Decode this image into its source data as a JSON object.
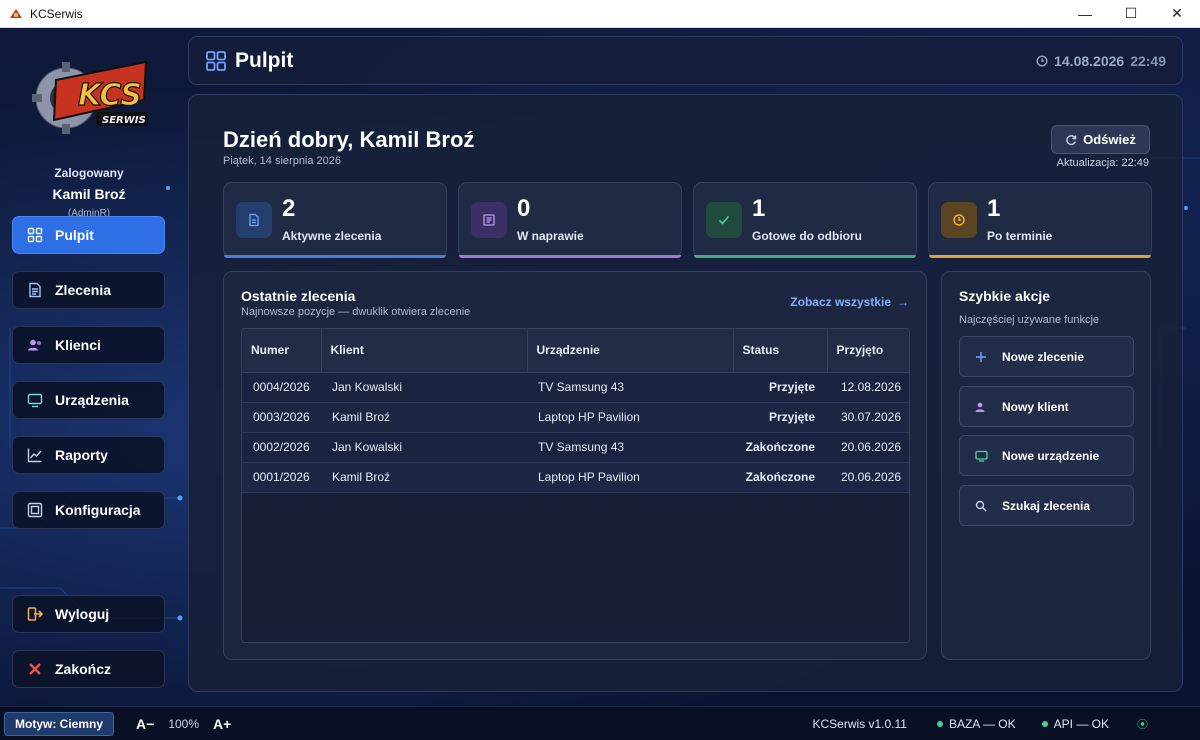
{
  "window": {
    "title": "KCSerwis",
    "controls": [
      "—",
      "☐",
      "✕"
    ]
  },
  "sidebar": {
    "logo_text": "KCS",
    "logo_sub": "SERWIS",
    "logged_label": "Zalogowany",
    "user_name": "Kamil Broź",
    "user_role": "(AdminR)",
    "items": [
      {
        "label": "Pulpit",
        "icon": "dashboard-icon",
        "active": true
      },
      {
        "label": "Zlecenia",
        "icon": "document-icon"
      },
      {
        "label": "Klienci",
        "icon": "users-icon"
      },
      {
        "label": "Urządzenia",
        "icon": "monitor-icon"
      },
      {
        "label": "Raporty",
        "icon": "chart-icon"
      },
      {
        "label": "Konfiguracja",
        "icon": "settings-icon"
      }
    ],
    "logout_label": "Wyloguj",
    "exit_label": "Zakończ"
  },
  "header": {
    "title": "Pulpit",
    "date": "14.08.2026",
    "time": "22:49"
  },
  "main": {
    "greeting": "Dzień dobry, Kamil Broź",
    "date_text": "Piątek, 14 sierpnia 2026",
    "refresh_label": "Odśwież",
    "updated_text": "Aktualizacja: 22:49",
    "stats": [
      {
        "value": "2",
        "label": "Aktywne zlecenia",
        "color": "#4a7fd8"
      },
      {
        "value": "0",
        "label": "W naprawie",
        "color": "#a07ad8"
      },
      {
        "value": "1",
        "label": "Gotowe do odbioru",
        "color": "#3fae86"
      },
      {
        "value": "1",
        "label": "Po terminie",
        "color": "#e0a23a"
      }
    ],
    "orders": {
      "title": "Ostatnie zlecenia",
      "subtitle": "Najnowsze pozycje — dwuklik otwiera zlecenie",
      "see_all": "Zobacz wszystkie",
      "see_all_arrow": "→",
      "columns": [
        "Numer",
        "Klient",
        "Urządzenie",
        "Status",
        "Przyjęto"
      ],
      "rows": [
        [
          "0004/2026",
          "Jan Kowalski",
          "TV Samsung 43",
          "Przyjęte",
          "12.08.2026"
        ],
        [
          "0003/2026",
          "Kamil Broź",
          "Laptop HP Pavilion",
          "Przyjęte",
          "30.07.2026"
        ],
        [
          "0002/2026",
          "Jan Kowalski",
          "TV Samsung 43",
          "Zakończone",
          "20.06.2026"
        ],
        [
          "0001/2026",
          "Kamil Broź",
          "Laptop HP Pavilion",
          "Zakończone",
          "20.06.2026"
        ]
      ]
    },
    "quick": {
      "title": "Szybkie akcje",
      "subtitle": "Najczęściej używane funkcje",
      "actions": [
        {
          "label": "Nowe zlecenie",
          "icon": "plus-icon"
        },
        {
          "label": "Nowy klient",
          "icon": "user-add-icon"
        },
        {
          "label": "Nowe urządzenie",
          "icon": "monitor-icon"
        },
        {
          "label": "Szukaj zlecenia",
          "icon": "search-icon"
        }
      ]
    }
  },
  "statusbar": {
    "theme_label": "Motyw: Ciemny",
    "font_dec": "A−",
    "zoom": "100%",
    "font_inc": "A+",
    "version": "KCSerwis v1.0.11",
    "db_status": "BAZA — OK",
    "api_status": "API — OK",
    "status_color": "#3fd19a"
  }
}
